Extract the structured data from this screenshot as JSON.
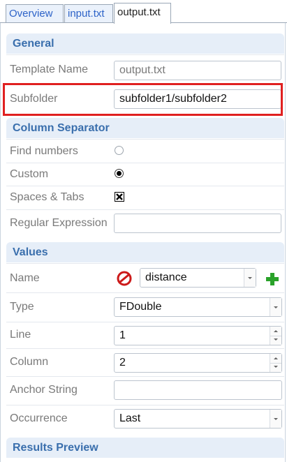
{
  "tabs": [
    {
      "label": "Overview"
    },
    {
      "label": "input.txt"
    },
    {
      "label": "output.txt"
    }
  ],
  "general": {
    "header": "General",
    "template_name_label": "Template Name",
    "template_name_value": "output.txt",
    "subfolder_label": "Subfolder",
    "subfolder_value": "subfolder1/subfolder2"
  },
  "column_separator": {
    "header": "Column Separator",
    "find_numbers_label": "Find numbers",
    "custom_label": "Custom",
    "spaces_tabs_label": "Spaces & Tabs",
    "regex_label": "Regular Expression",
    "regex_value": ""
  },
  "values": {
    "header": "Values",
    "name_label": "Name",
    "name_value": "distance",
    "type_label": "Type",
    "type_value": "FDouble",
    "line_label": "Line",
    "line_value": "1",
    "column_label": "Column",
    "column_value": "2",
    "anchor_label": "Anchor String",
    "anchor_value": "",
    "occurrence_label": "Occurrence",
    "occurrence_value": "Last"
  },
  "results_preview": {
    "header": "Results Preview"
  },
  "colors": {
    "accent_red": "#e02020",
    "section_header_text": "#3a6fad",
    "section_header_bg": "#e6eef8",
    "add_green": "#2aa22a",
    "remove_red": "#cc1a1a"
  },
  "icons": [
    "remove-icon",
    "add-icon"
  ]
}
